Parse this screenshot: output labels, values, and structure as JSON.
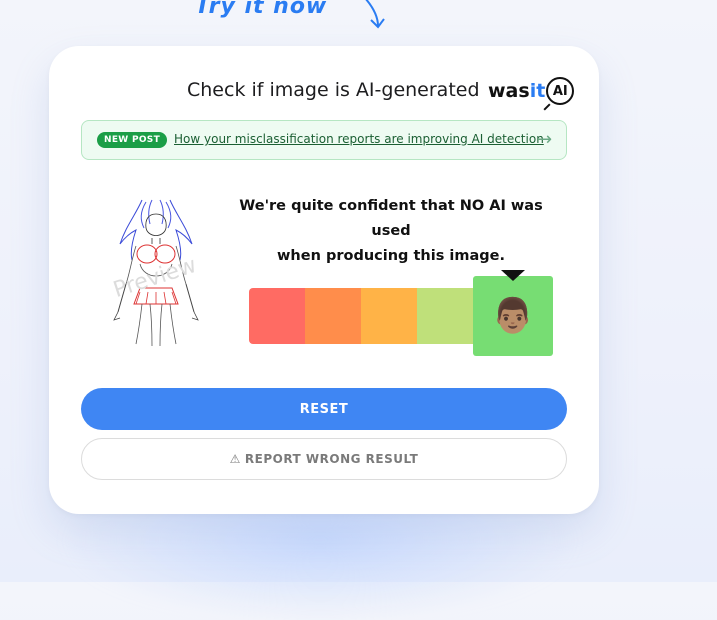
{
  "tagline": "Try it now",
  "card": {
    "title": "Check if image is AI-generated",
    "logo": {
      "wa": "was",
      "it": "it",
      "ai": "AI",
      "accent": "#2a7cf2"
    }
  },
  "news": {
    "badge": "NEW POST",
    "link_text": "How your misclassification reports are improving AI detection",
    "arrow": "→"
  },
  "preview": {
    "watermark": "Preview"
  },
  "result": {
    "line1": "We're quite confident that NO AI was used",
    "line2": "when producing this image.",
    "scale_colors": [
      "#ff6b63",
      "#ff8d4b",
      "#ffb347",
      "#bfe07a",
      "#77dd73"
    ],
    "selected_level": 5,
    "selected_icon": "person-face-icon",
    "selected_emoji": "👨🏽"
  },
  "buttons": {
    "reset": "RESET",
    "report": "REPORT WRONG RESULT",
    "report_icon": "⚠"
  }
}
